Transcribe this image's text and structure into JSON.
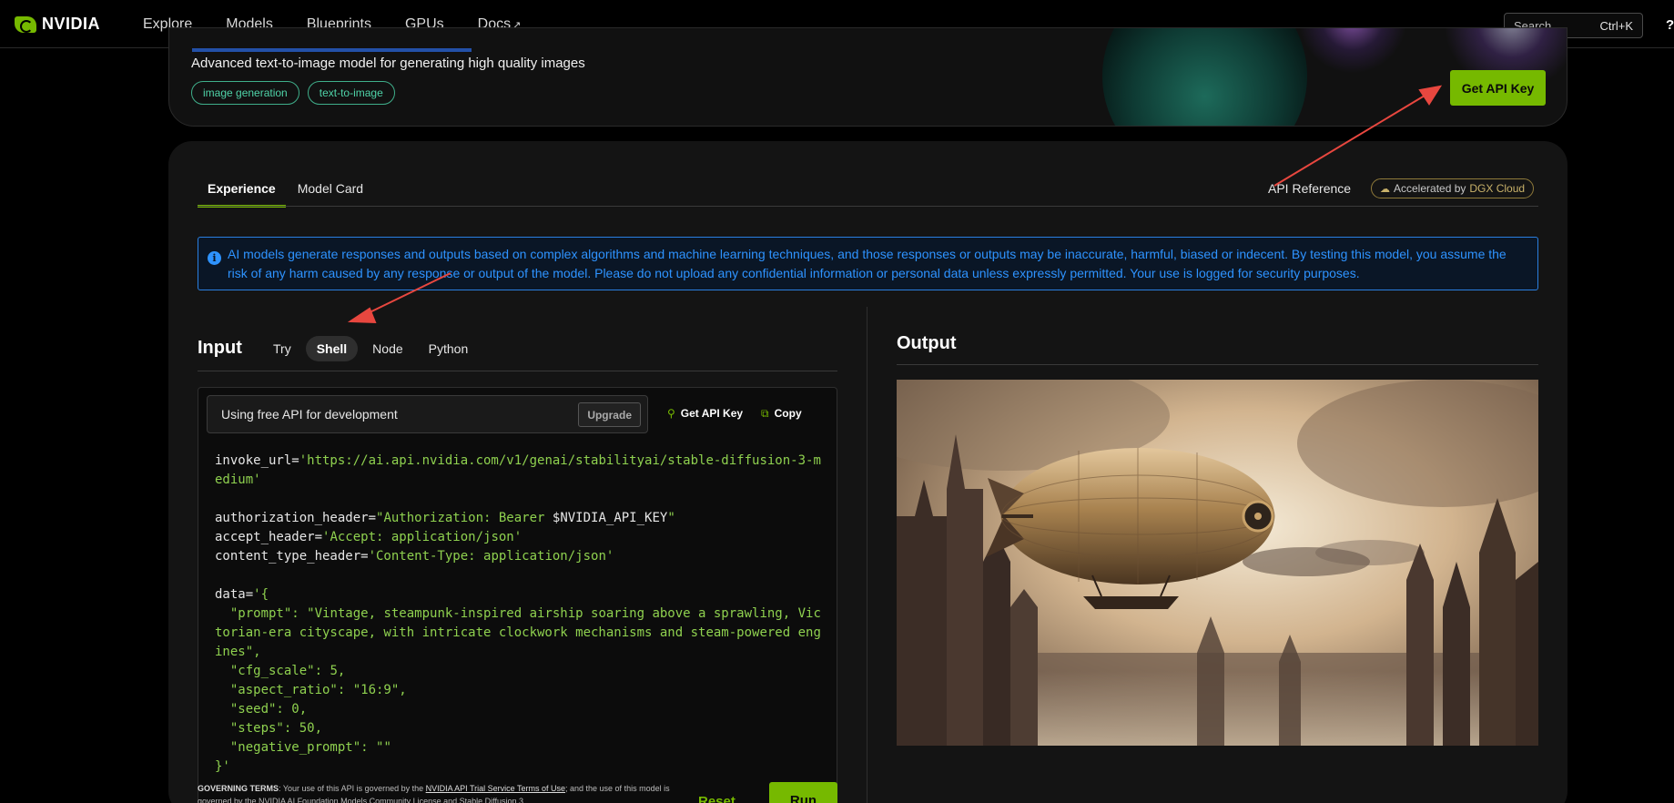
{
  "nav": {
    "logo_text": "NVIDIA",
    "items": [
      "Explore",
      "Models",
      "Blueprints",
      "GPUs",
      "Docs"
    ],
    "docs_external_glyph": "↗",
    "search_placeholder": "Search",
    "search_shortcut": "Ctrl+K",
    "help_label": "?"
  },
  "hero": {
    "description": "Advanced text-to-image model for generating high quality images",
    "tags": [
      "image generation",
      "text-to-image"
    ],
    "api_key_button": "Get API Key"
  },
  "tabs": {
    "items": [
      "Experience",
      "Model Card"
    ],
    "active": "Experience",
    "api_reference": "API Reference",
    "badge_prefix": "Accelerated by ",
    "badge_highlight": "DGX Cloud"
  },
  "notice": {
    "icon": "i",
    "text": "AI models generate responses and outputs based on complex algorithms and machine learning techniques, and those responses or outputs may be inaccurate, harmful, biased or indecent. By testing this model, you assume the risk of any harm caused by any response or output of the model. Please do not upload any confidential information or personal data unless expressly permitted. Your use is logged for security purposes."
  },
  "input": {
    "title": "Input",
    "subtabs": [
      "Try",
      "Shell",
      "Node",
      "Python"
    ],
    "active_subtab": "Shell",
    "free_api_text": "Using free API for development",
    "upgrade_label": "Upgrade",
    "get_api_key_label": "Get API Key",
    "copy_label": "Copy",
    "code": {
      "line1_key": "invoke_url=",
      "line1_val": "'https://ai.api.nvidia.com/v1/genai/stabilityai/stable-diffusion-3-medium'",
      "line2_key": "authorization_header=",
      "line2_val": "\"Authorization: Bearer ",
      "line2_var": "$NVIDIA_API_KEY",
      "line2_end": "\"",
      "line3_key": "accept_header=",
      "line3_val": "'Accept: application/json'",
      "line4_key": "content_type_header=",
      "line4_val": "'Content-Type: application/json'",
      "line5_key": "data=",
      "line5_val": "'{",
      "prompt_key": "  \"prompt\": ",
      "prompt_val": "\"Vintage, steampunk-inspired airship soaring above a sprawling, Victorian-era cityscape, with intricate clockwork mechanisms and steam-powered engines\",",
      "cfg_key": "  \"cfg_scale\": ",
      "cfg_val": "5,",
      "aspect_key": "  \"aspect_ratio\": ",
      "aspect_val": "\"16:9\",",
      "seed_key": "  \"seed\": ",
      "seed_val": "0,",
      "steps_key": "  \"steps\": ",
      "steps_val": "50,",
      "neg_key": "  \"negative_prompt\": ",
      "neg_val": "\"\"",
      "close": "}'"
    }
  },
  "footer": {
    "gov_label": "GOVERNING TERMS",
    "gov_text1": ": Your use of this API is governed by the ",
    "gov_link1": "NVIDIA API Trial Service Terms of Use",
    "gov_text2": "; and the use of this model is governed by the NVIDIA AI Foundation Models Community License and Stable Diffusion 3",
    "reset_label": "Reset",
    "run_label": "Run"
  },
  "output": {
    "title": "Output"
  },
  "colors": {
    "accent": "#76b900",
    "notice_blue": "#2e93ff",
    "tag_teal": "#4fd3a8",
    "code_string": "#8fd14f",
    "annotation_arrow": "#e8473f"
  }
}
